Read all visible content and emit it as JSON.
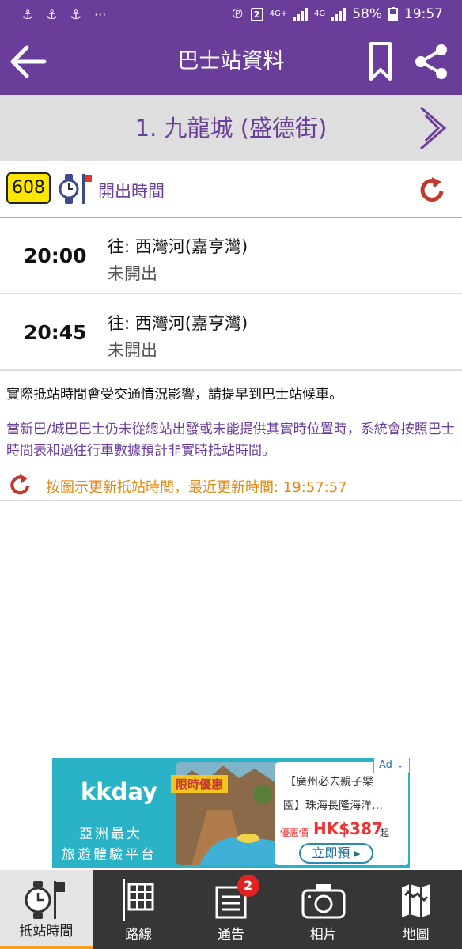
{
  "status_bar": {
    "notification_icons": [
      "app-icon",
      "app-icon",
      "app-icon"
    ],
    "more": "···",
    "sim_badge": "2",
    "net1": "4G+",
    "net2": "4G",
    "battery": "58%",
    "time": "19:57"
  },
  "header": {
    "title": "巴士站資料"
  },
  "stop": {
    "name": "1. 九龍城 (盛德街)"
  },
  "route": {
    "number": "608",
    "label": "開出時間"
  },
  "etas": [
    {
      "time": "20:00",
      "destination": "往: 西灣河(嘉亨灣)",
      "status": "未開出"
    },
    {
      "time": "20:45",
      "destination": "往: 西灣河(嘉亨灣)",
      "status": "未開出"
    }
  ],
  "notes": {
    "traffic": "實際抵站時間會受交通情況影響，請提早到巴士站候車。",
    "estimate": "當新巴/城巴巴士仍未從總站出發或未能提供其實時位置時，系統會按照巴士時間表和過往行車數據預計非實時抵站時間。",
    "update": "按圖示更新抵站時間，最近更新時間: 19:57:57"
  },
  "ad": {
    "brand": "kkday",
    "tagline_1": "亞洲最大",
    "tagline_2": "旅遊體驗平台",
    "promo": "限時優惠",
    "line_1": "【廣州必去親子樂",
    "line_2": "園】珠海長隆海洋…",
    "price_label": "優惠價",
    "price": "HK$387",
    "price_suffix": "起",
    "cta": "立即預",
    "ad_chip": "Ad"
  },
  "bottom_nav": {
    "items": [
      {
        "label": "抵站時間"
      },
      {
        "label": "路線"
      },
      {
        "label": "通告",
        "badge": "2"
      },
      {
        "label": "相片"
      },
      {
        "label": "地圖"
      }
    ]
  },
  "colors": {
    "primary": "#6a3d9a",
    "accent": "#f0a020",
    "refresh": "#c0392b",
    "route_badge": "#ffe600"
  }
}
